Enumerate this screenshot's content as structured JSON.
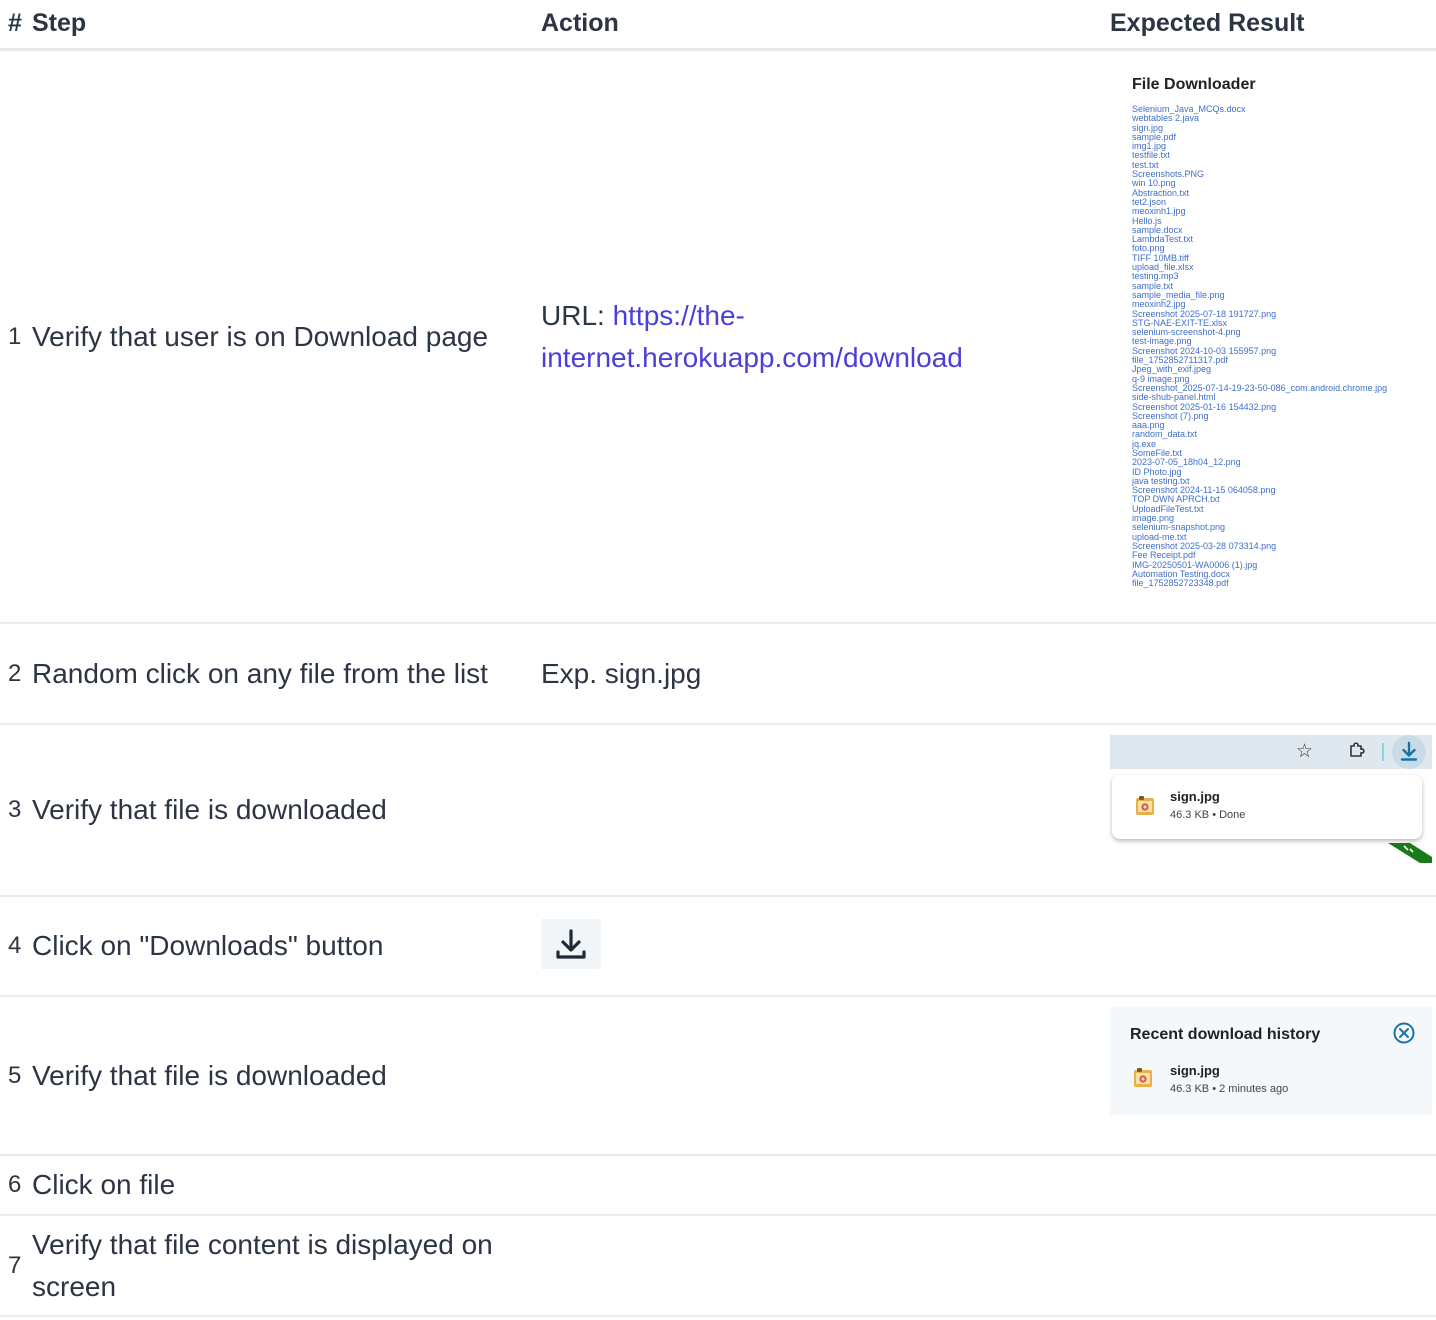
{
  "table": {
    "headers": {
      "num": "#",
      "step": "Step",
      "action": "Action",
      "expected": "Expected Result"
    },
    "rows": [
      {
        "num": "1",
        "step": "Verify that user is on Download page",
        "action_prefix": "URL: ",
        "action_link": "https://the-internet.herokuapp.com/download"
      },
      {
        "num": "2",
        "step": "Random click on any file from the list",
        "action": "Exp. sign.jpg"
      },
      {
        "num": "3",
        "step": "Verify that file is downloaded"
      },
      {
        "num": "4",
        "step": "Click on \"Downloads\" button"
      },
      {
        "num": "5",
        "step": "Verify that file is downloaded"
      },
      {
        "num": "6",
        "step": "Click on file"
      },
      {
        "num": "7",
        "step": "Verify that file content is displayed on screen"
      }
    ]
  },
  "file_downloader": {
    "title": "File Downloader",
    "files": [
      "Selenium_Java_MCQs.docx",
      "webtables 2.java",
      "sign.jpg",
      "sample.pdf",
      "img1.jpg",
      "testfile.txt",
      "test.txt",
      "Screenshots.PNG",
      "win 10.png",
      "Abstraction.txt",
      "tet2.json",
      "meoxinh1.jpg",
      "Hello.js",
      "sample.docx",
      "LambdaTest.txt",
      "foto.png",
      "TIFF 10MB.tiff",
      "upload_file.xlsx",
      "testing.mp3",
      "sample.txt",
      "sample_media_file.png",
      "meoxinh2.jpg",
      "Screenshot 2025-07-18 191727.png",
      "STG-NAE-EXIT-TE.xlsx",
      "selenium-screenshot-4.png",
      "test-image.png",
      "Screenshot 2024-10-03 155957.png",
      "file_1752852711317.pdf",
      "Jpeg_with_exif.jpeg",
      "q-9 image.png",
      "Screenshot_2025-07-14-19-23-50-086_com.android.chrome.jpg",
      "side-shub-panel.html",
      "Screenshot 2025-01-16 154432.png",
      "Screenshot (7).png",
      "aaa.png",
      "random_data.txt",
      "jq.exe",
      "SomeFile.txt",
      "2023-07-05_18h04_12.png",
      "ID Photo.jpg",
      "java testing.txt",
      "Screenshot 2024-11-15 064058.png",
      "TOP DWN APRCH.txt",
      "UploadFileTest.txt",
      "image.png",
      "selenium-snapshot.png",
      "upload-me.txt",
      "Screenshot 2025-03-28 073314.png",
      "Fee Receipt.pdf",
      "IMG-20250501-WA0006 (1).jpg",
      "Automation Testing.docx",
      "file_1752852723348.pdf"
    ]
  },
  "download_popup": {
    "file_name": "sign.jpg",
    "meta": "46.3 KB • Done"
  },
  "history": {
    "title": "Recent download history",
    "file_name": "sign.jpg",
    "meta": "46.3 KB • 2 minutes ago"
  },
  "icons": {
    "star": "star-icon",
    "extensions": "puzzle-icon",
    "download": "download-icon",
    "file": "image-file-icon",
    "close": "close-circle-icon"
  },
  "colors": {
    "link": "#4a3fd8",
    "file_links": "#3f6fc8",
    "download_accent": "#1a73a8",
    "text": "#2b3544"
  }
}
